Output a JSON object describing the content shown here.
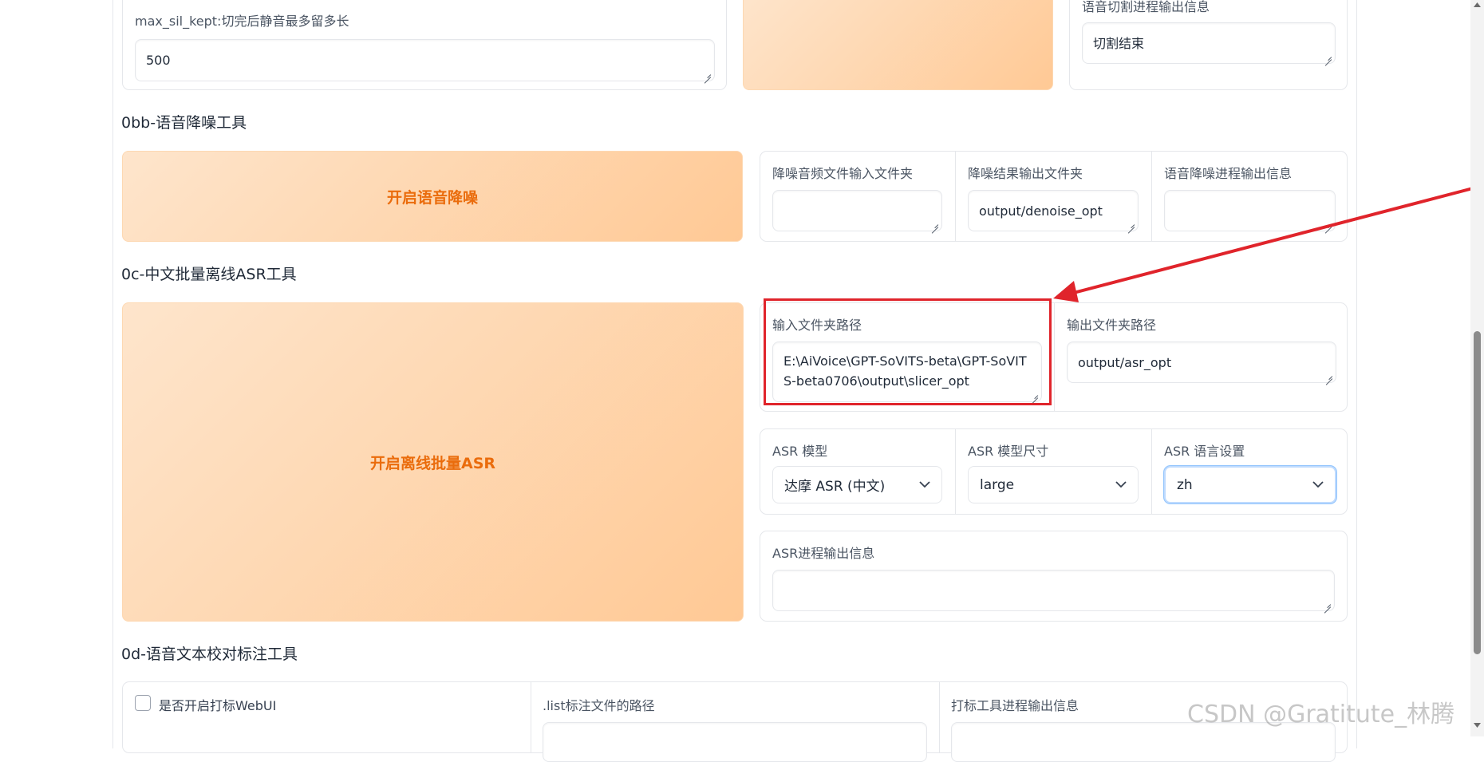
{
  "slicer": {
    "max_sil_label": "max_sil_kept:切完后静音最多留多长",
    "max_sil_value": "500",
    "output_label": "语音切割进程输出信息",
    "output_value": "切割结束"
  },
  "denoise": {
    "section_title": "0bb-语音降噪工具",
    "button_label": "开启语音降噪",
    "input_label": "降噪音频文件输入文件夹",
    "input_value": "",
    "output_label": "降噪结果输出文件夹",
    "output_value": "output/denoise_opt",
    "info_label": "语音降噪进程输出信息",
    "info_value": ""
  },
  "asr": {
    "section_title": "0c-中文批量离线ASR工具",
    "button_label": "开启离线批量ASR",
    "input_label": "输入文件夹路径",
    "input_value": "E:\\AiVoice\\GPT-SoVITS-beta\\GPT-SoVITS-beta0706\\output\\slicer_opt",
    "output_label": "输出文件夹路径",
    "output_value": "output/asr_opt",
    "model_label": "ASR 模型",
    "model_value": "达摩 ASR (中文)",
    "size_label": "ASR 模型尺寸",
    "size_value": "large",
    "lang_label": "ASR 语言设置",
    "lang_value": "zh",
    "info_label": "ASR进程输出信息",
    "info_value": ""
  },
  "label_tool": {
    "section_title": "0d-语音文本校对标注工具",
    "checkbox_label": "是否开启打标WebUI",
    "list_path_label": ".list标注文件的路径",
    "info_label": "打标工具进程输出信息"
  },
  "watermark": "CSDN @Gratitute_林腾",
  "colors": {
    "accent_orange": "#ea6c0c",
    "button_gradient_start": "#fee5cc",
    "button_gradient_end": "#ffc995",
    "highlight_red": "#e0242b"
  }
}
